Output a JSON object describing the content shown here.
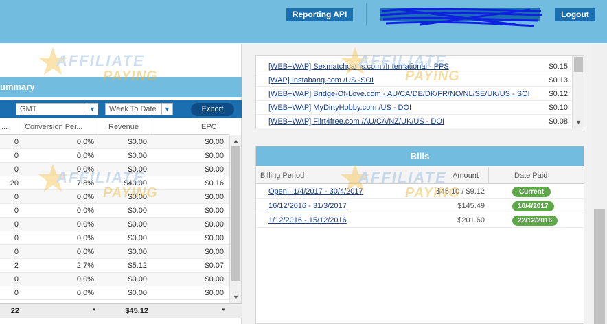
{
  "header": {
    "reporting_api_label": "Reporting API",
    "logout_label": "Logout",
    "user_label": ""
  },
  "watermark": {
    "line1": "AFFILIATE",
    "line2": "PAYING"
  },
  "summary": {
    "title": "ummary",
    "timezone": "GMT",
    "range": "Week To Date",
    "export_label": "Export",
    "columns": [
      "...",
      "Conversion Per...",
      "Revenue",
      "EPC"
    ],
    "rows": [
      [
        "0",
        "0.0%",
        "$0.00",
        "$0.00"
      ],
      [
        "0",
        "0.0%",
        "$0.00",
        "$0.00"
      ],
      [
        "0",
        "0.0%",
        "$0.00",
        "$0.00"
      ],
      [
        "20",
        "7.8%",
        "$40.00",
        "$0.16"
      ],
      [
        "0",
        "0.0%",
        "$0.00",
        "$0.00"
      ],
      [
        "0",
        "0.0%",
        "$0.00",
        "$0.00"
      ],
      [
        "0",
        "0.0%",
        "$0.00",
        "$0.00"
      ],
      [
        "0",
        "0.0%",
        "$0.00",
        "$0.00"
      ],
      [
        "0",
        "0.0%",
        "$0.00",
        "$0.00"
      ],
      [
        "2",
        "2.7%",
        "$5.12",
        "$0.07"
      ],
      [
        "0",
        "0.0%",
        "$0.00",
        "$0.00"
      ],
      [
        "0",
        "0.0%",
        "$0.00",
        "$0.00"
      ]
    ],
    "totals": [
      "22",
      "*",
      "$45.12",
      "*"
    ]
  },
  "offers": [
    {
      "name": "[WEB+WAP] Sexmatchcams.com /International - PPS",
      "amount": "$0.15"
    },
    {
      "name": "[WAP] Instabang.com /US -SOI",
      "amount": "$0.13"
    },
    {
      "name": "[WEB+WAP] Bridge-Of-Love.com - AU/CA/DE/DK/FR/NO/NL/SE/UK/US - SOI",
      "amount": "$0.12"
    },
    {
      "name": "[WEB+WAP] MyDirtyHobby.com /US - DOI",
      "amount": "$0.10"
    },
    {
      "name": "[WEB+WAP] Flirt4free.com /AU/CA/NZ/UK/US - DOI",
      "amount": "$0.08"
    }
  ],
  "bills": {
    "title": "Bills",
    "columns": [
      "Billing Period",
      "Amount",
      "Date Paid"
    ],
    "rows": [
      {
        "period": "Open : 1/4/2017 - 30/4/2017",
        "amount": "$45.10 / $9.12",
        "date": "Current"
      },
      {
        "period": "16/12/2016 - 31/3/2017",
        "amount": "$145.49",
        "date": "10/4/2017"
      },
      {
        "period": "1/12/2016 - 15/12/2016",
        "amount": "$201.60",
        "date": "22/12/2016"
      }
    ]
  }
}
